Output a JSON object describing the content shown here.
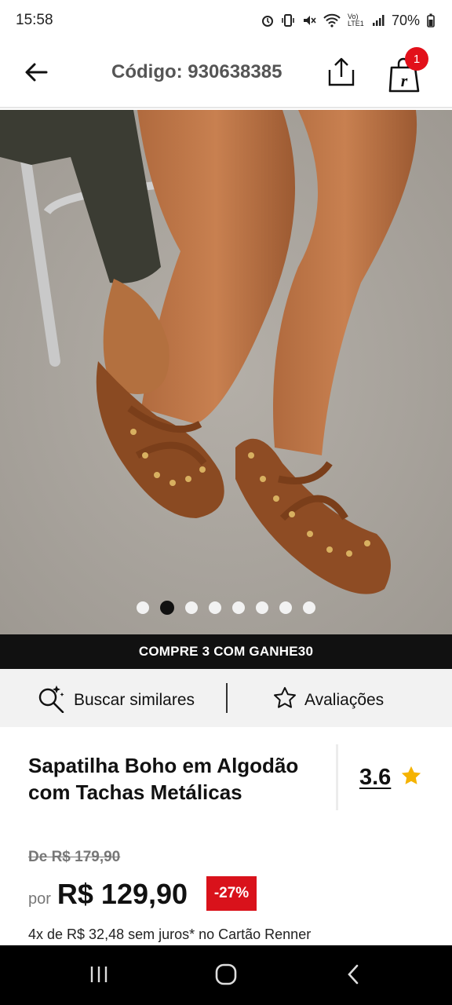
{
  "status_bar": {
    "time": "15:58",
    "battery": "70%",
    "network": "Vo) LTE1",
    "icons": [
      "alarm-icon",
      "vibrate-icon",
      "mute-icon",
      "wifi-icon",
      "signal-icon",
      "battery-icon"
    ]
  },
  "header": {
    "title": "Código: 930638385",
    "back_icon": "back-arrow-icon",
    "share_icon": "share-icon",
    "cart_icon": "shopping-bag-icon",
    "cart_count": "1",
    "cart_logo_letter": "r"
  },
  "carousel": {
    "total_images": 8,
    "active_index": 1
  },
  "promo_banner": {
    "text": "COMPRE 3 COM GANHE30"
  },
  "actions": {
    "similar_label": "Buscar similares",
    "reviews_label": "Avaliações"
  },
  "product": {
    "title": "Sapatilha Boho em Algodão com Tachas Metálicas",
    "rating": "3.6",
    "old_price": "De R$ 179,90",
    "price_prefix": "por",
    "price": "R$ 129,90",
    "discount": "-27%",
    "installments": "4x de R$ 32,48 sem juros* no Cartão Renner"
  },
  "colors": {
    "badge_red": "#e2101a",
    "discount_red": "#d9121b",
    "star_gold": "#f5b301",
    "promo_bg": "#111111"
  }
}
